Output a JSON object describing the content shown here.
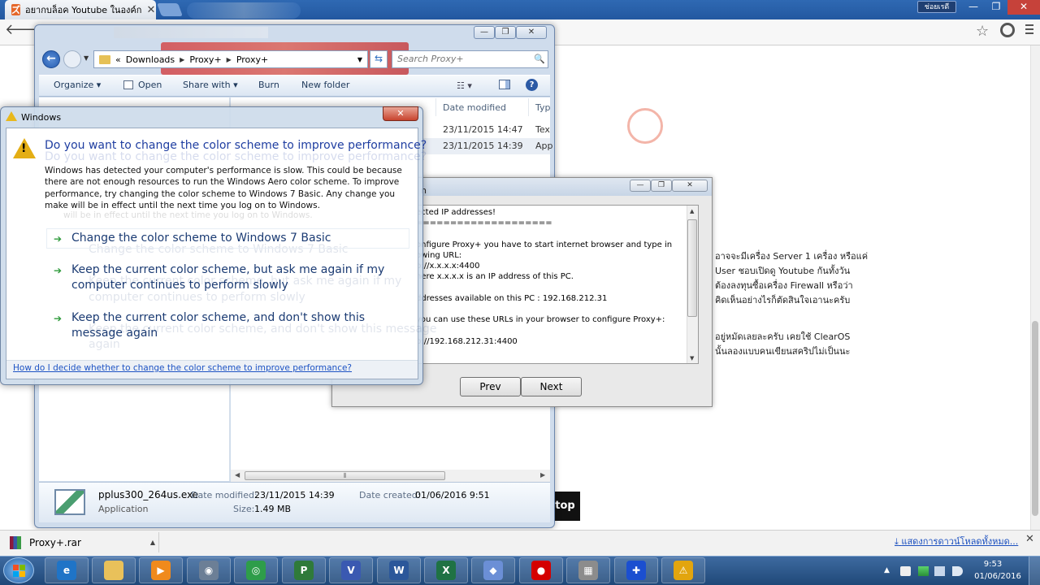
{
  "browser": {
    "tab_title": "อยากบล็อค Youtube ในองค์ก",
    "tab_logo": "ズ",
    "tab_close": "✕",
    "user_button": "ช่อยเรดี",
    "controls": {
      "minimize": "—",
      "maximize": "❐",
      "close": "✕"
    },
    "back_icon": "🡐",
    "star_icon": "☆"
  },
  "page": {
    "thai_text": [
      "อาจจะมีเครื่อง Server 1 เครื่อง หรือแค่",
      "User ชอบเปิดดู Youtube กันทั้งวัน",
      "ต้องลงทุนซื้อเครื่อง Firewall หรือว่า",
      "คิดเห็นอย่างไรก็ตัดสินใจเอานะครับ",
      "อยู่หมัดเลยละครับ เคยใช้ ClearOS",
      "นั้นลองแบบคนเขียนสคริปไม่เป็นนะ"
    ],
    "stop_badge": "top"
  },
  "explorer": {
    "controls": {
      "minimize": "—",
      "maximize": "❐",
      "close": "✕"
    },
    "back_arrow": "←",
    "history_caret": "▼",
    "breadcrumb_prefix": "«",
    "breadcrumb": [
      "Downloads",
      "Proxy+",
      "Proxy+"
    ],
    "crumb_separator": "▶",
    "address_dropdown": "▼",
    "refresh_icon": "⇆",
    "search_placeholder": "Search Proxy+",
    "search_icon": "🔍",
    "commands": {
      "organize": "Organize ▾",
      "open": "Open",
      "share_with": "Share with ▾",
      "burn": "Burn",
      "new_folder": "New folder"
    },
    "view_icon": "☷ ▾",
    "help_icon": "?",
    "columns": {
      "date_modified": "Date modified",
      "type": "Typ"
    },
    "rows": [
      {
        "date": "23/11/2015 14:47",
        "type": "Tex"
      },
      {
        "date": "23/11/2015 14:39",
        "type": "App"
      }
    ],
    "hscroll": {
      "left": "◀",
      "thumb": "⦀",
      "right": "▶"
    },
    "details": {
      "file_name": "pplus300_264us.exe",
      "file_type": "Application",
      "date_modified_label": "Date modified:",
      "date_modified_value": "23/11/2015 14:39",
      "size_label": "Size:",
      "size_value": "1.49 MB",
      "date_created_label": "Date created:",
      "date_created_value": "01/06/2016 9:51"
    }
  },
  "proxy": {
    "title_fragment": "n",
    "controls": {
      "minimize": "—",
      "maximize": "❐",
      "close": "✕"
    },
    "lines": [
      "ected IP addresses!",
      "====================",
      "onfigure Proxy+ you have to start internet browser and type in",
      "owing URL:",
      "p://x.x.x.x:4400",
      "here x.x.x.x is an IP address of this PC.",
      "ddresses available on this PC : 192.168.212.31",
      "you can use these URLs in your browser to configure Proxy+:",
      "p://192.168.212.31:4400"
    ],
    "scroll_up": "▲",
    "scroll_down": "▼",
    "prev_label": "Prev",
    "next_label": "Next"
  },
  "dialog": {
    "title": "Windows",
    "close": "✕",
    "warning_mark": "!",
    "heading": "Do you want to change the color scheme to improve performance?",
    "description": "Windows has detected your computer's performance is slow. This could be because there are not enough resources to run the Windows Aero color scheme. To improve performance, try changing the color scheme to Windows 7 Basic. Any change you make will be in effect until the next time you log on to Windows.",
    "ghost_description": "will be in effect until the next time you log on to Windows.",
    "option_arrow": "➔",
    "options": [
      "Change the color scheme to Windows 7 Basic",
      "Keep the current color scheme, but ask me again if my computer continues to perform slowly",
      "Keep the current color scheme, and don't show this message again"
    ],
    "ghost_options": [
      "Change the color scheme to Windows 7 Basic",
      "Keep the current color scheme, but ask me again if my",
      "computer continues to perform slowly",
      "Keep the current color scheme, and don't show this message",
      "again"
    ],
    "help_link": "How do I decide whether to change the color scheme to improve performance?"
  },
  "downloads": {
    "file": "Proxy+.rar",
    "caret": "▲",
    "show_all": "แสดงการดาวน์โหลดทั้งหมด...",
    "download_icon": "⤓",
    "close": "✕"
  },
  "taskbar": {
    "apps": [
      {
        "name": "internet-explorer",
        "label": "e",
        "color": "#1f74c7"
      },
      {
        "name": "file-explorer",
        "label": "",
        "color": "#e9c15a"
      },
      {
        "name": "media-player",
        "label": "▶",
        "color": "#f08a1c"
      },
      {
        "name": "network-tool",
        "label": "◉",
        "color": "#6c7f96"
      },
      {
        "name": "chrome",
        "label": "◎",
        "color": "#2e9d4a"
      },
      {
        "name": "project",
        "label": "P",
        "color": "#2f7a3a"
      },
      {
        "name": "visio",
        "label": "V",
        "color": "#3a59b1"
      },
      {
        "name": "word",
        "label": "W",
        "color": "#2b579a"
      },
      {
        "name": "excel",
        "label": "X",
        "color": "#1f7244"
      },
      {
        "name": "virtualbox",
        "label": "◆",
        "color": "#6b8fd6"
      },
      {
        "name": "recorder",
        "label": "●",
        "color": "#d40000"
      },
      {
        "name": "calculator",
        "label": "▦",
        "color": "#8c8c8c"
      },
      {
        "name": "proxy-plus",
        "label": "✚",
        "color": "#1b4fd0"
      },
      {
        "name": "warning-app",
        "label": "⚠",
        "color": "#e2a50e"
      }
    ],
    "tray_arrow": "▲",
    "time": "9:53",
    "date": "01/06/2016"
  }
}
